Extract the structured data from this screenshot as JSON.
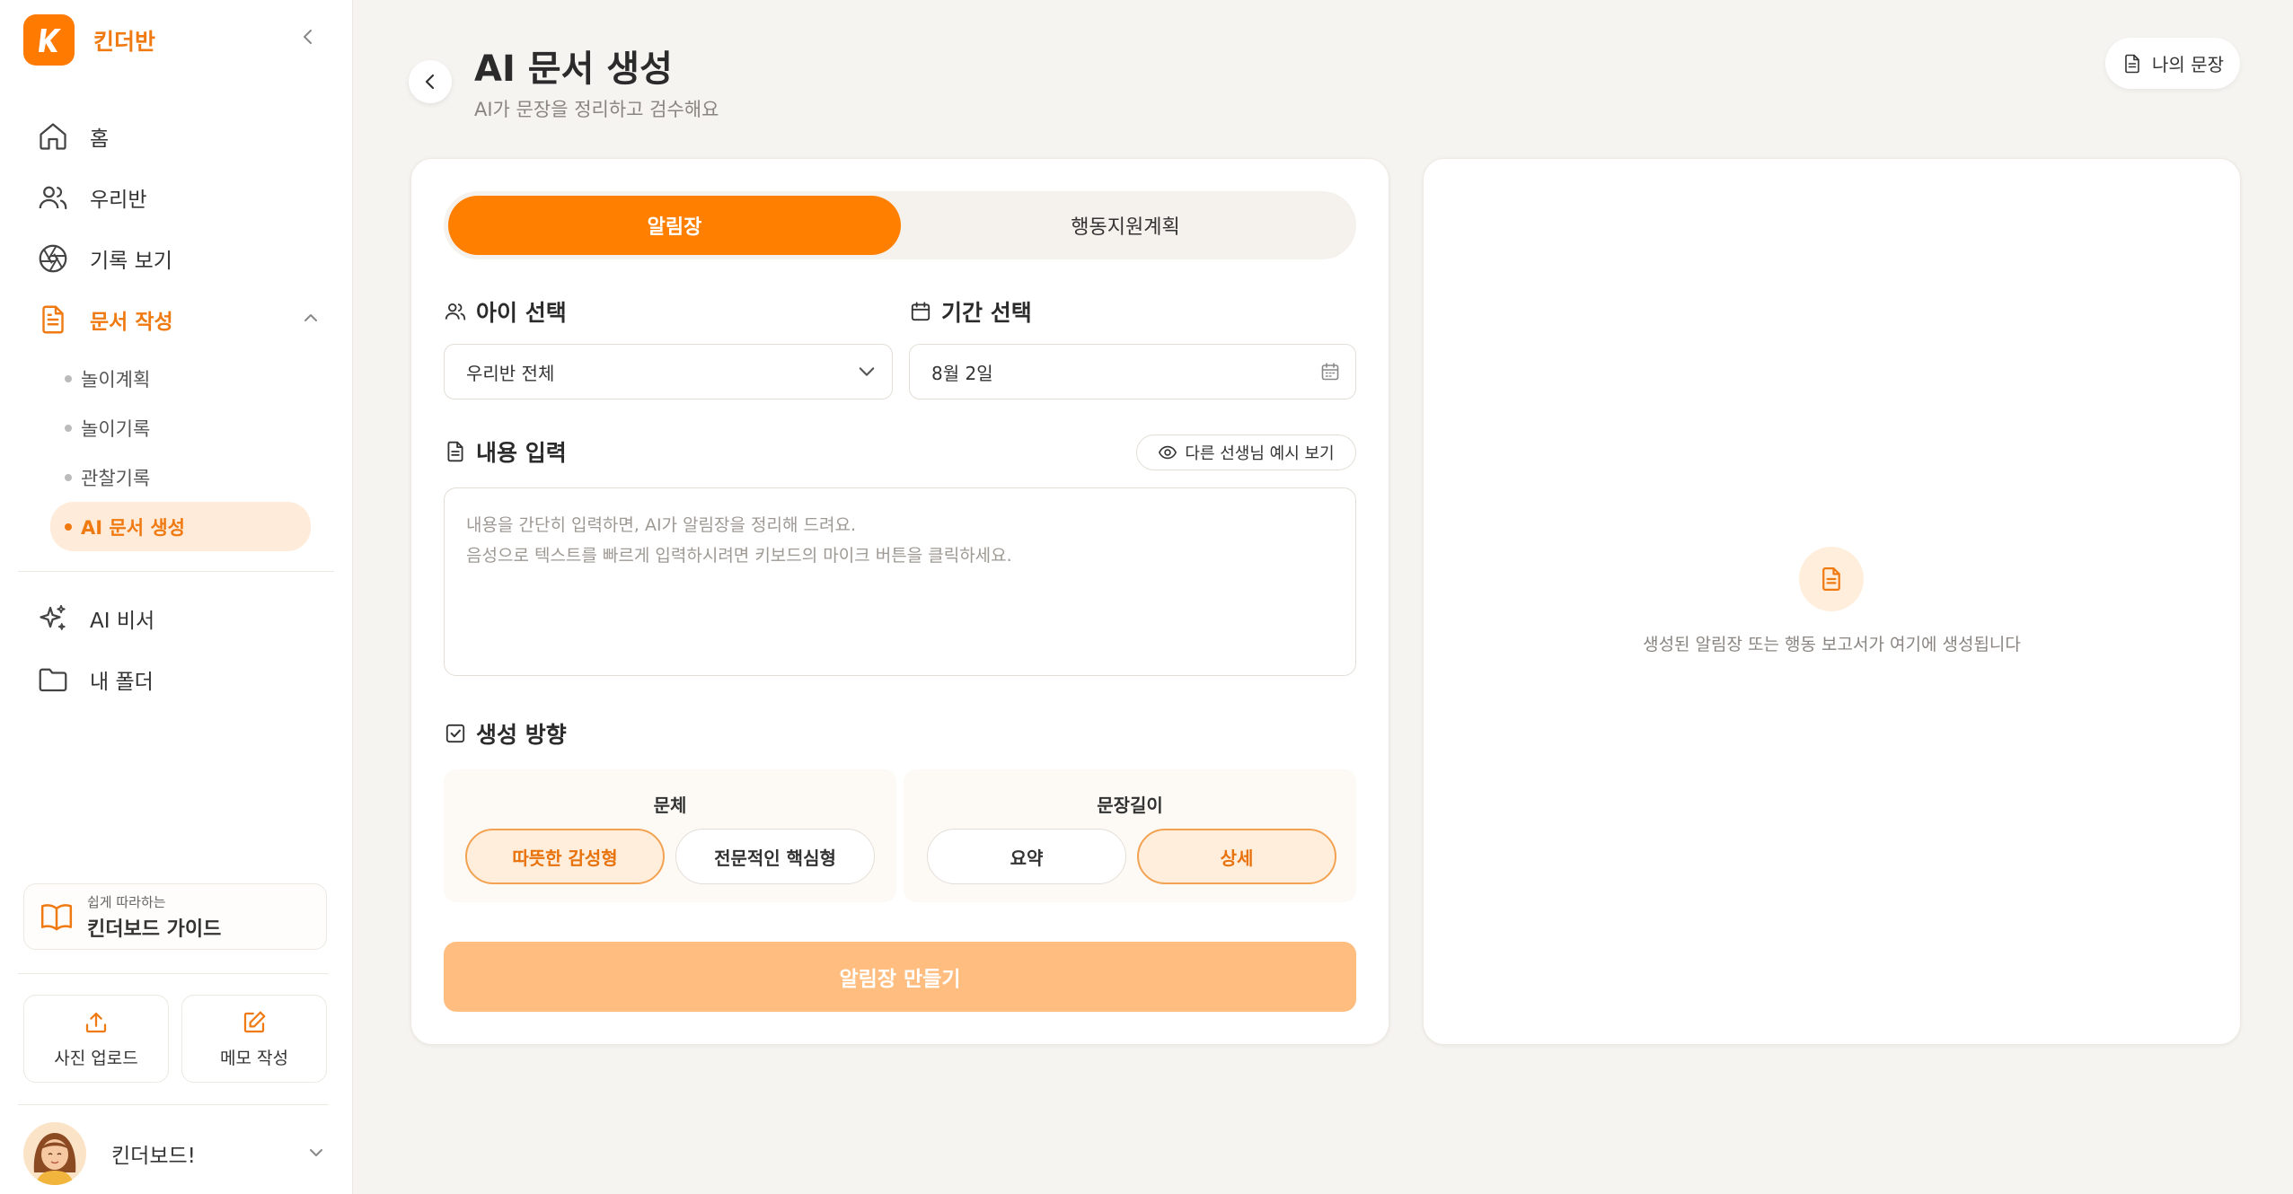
{
  "colors": {
    "accent": "#FF7F00",
    "accent_light": "#FFEBD9",
    "background": "#F6F4F0",
    "submit_disabled": "#FFBE80"
  },
  "brand": {
    "logo_letter": "K",
    "name": "킨더반"
  },
  "sidebar": {
    "items": [
      {
        "label": "홈",
        "icon": "home-icon"
      },
      {
        "label": "우리반",
        "icon": "users-icon"
      },
      {
        "label": "기록 보기",
        "icon": "aperture-icon"
      },
      {
        "label": "문서 작성",
        "icon": "document-icon",
        "active": true,
        "expanded": true
      }
    ],
    "sub_items": [
      {
        "label": "놀이계획"
      },
      {
        "label": "놀이기록"
      },
      {
        "label": "관찰기록"
      },
      {
        "label": "AI 문서 생성",
        "active": true
      }
    ],
    "extra_items": [
      {
        "label": "AI 비서",
        "icon": "sparkle-icon"
      },
      {
        "label": "내 폴더",
        "icon": "folder-icon"
      }
    ],
    "guide": {
      "small": "쉽게 따라하는",
      "big": "킨더보드 가이드"
    },
    "quick_actions": [
      {
        "label": "사진 업로드",
        "icon": "upload-icon"
      },
      {
        "label": "메모 작성",
        "icon": "edit-icon"
      }
    ],
    "profile": {
      "name": "킨더보드!"
    }
  },
  "header": {
    "title": "AI 문서 생성",
    "subtitle": "AI가 문장을 정리하고 검수해요",
    "my_docs_label": "나의 문장"
  },
  "form": {
    "tabs": [
      {
        "label": "알림장",
        "active": true
      },
      {
        "label": "행동지원계획",
        "active": false
      }
    ],
    "child_select": {
      "title": "아이 선택",
      "value": "우리반 전체"
    },
    "period_select": {
      "title": "기간 선택",
      "value": "8월 2일"
    },
    "content": {
      "title": "내용 입력",
      "example_button": "다른 선생님 예시 보기",
      "placeholder_line1": "내용을 간단히 입력하면, AI가 알림장을 정리해 드려요.",
      "placeholder_line2": "음성으로 텍스트를 빠르게 입력하시려면 키보드의 마이크 버튼을 클릭하세요."
    },
    "direction": {
      "title": "생성 방향",
      "style": {
        "title": "문체",
        "options": [
          "따뜻한 감성형",
          "전문적인 핵심형"
        ],
        "selected": "따뜻한 감성형"
      },
      "length": {
        "title": "문장길이",
        "options": [
          "요약",
          "상세"
        ],
        "selected": "상세"
      }
    },
    "submit_label": "알림장 만들기"
  },
  "preview": {
    "empty_text": "생성된 알림장 또는 행동 보고서가 여기에 생성됩니다"
  }
}
